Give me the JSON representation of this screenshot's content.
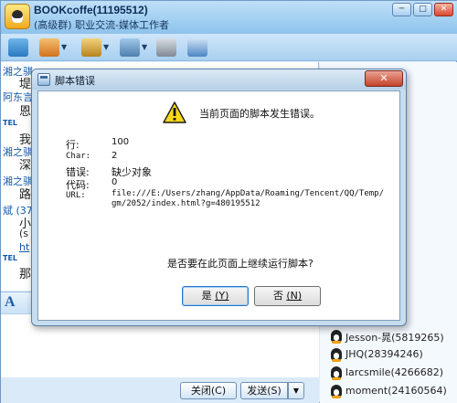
{
  "window": {
    "group_name": "BOOKcoffe(11195512)",
    "group_subtitle": "(高级群) 职业交流-媒体工作者",
    "controls": {
      "minimize": "─",
      "maximize": "□",
      "close": "✕"
    }
  },
  "toolbar": {
    "icons": [
      "group-chat-icon",
      "home-icon",
      "share-icon",
      "album-icon",
      "tools-icon",
      "settings-icon"
    ]
  },
  "chat": {
    "lines": [
      {
        "kind": "sender",
        "text": "湘之骐"
      },
      {
        "kind": "msg",
        "text": "堤"
      },
      {
        "kind": "sender",
        "text": "阿东言"
      },
      {
        "kind": "msg",
        "text": "恩"
      },
      {
        "kind": "tel",
        "text": "TEL"
      },
      {
        "kind": "msg",
        "text": "我"
      },
      {
        "kind": "sender",
        "text": "湘之骐"
      },
      {
        "kind": "msg",
        "text": "深"
      },
      {
        "kind": "sender",
        "text": "湘之骐"
      },
      {
        "kind": "msg",
        "text": "路"
      },
      {
        "kind": "sender",
        "text": "斌 (37"
      },
      {
        "kind": "msg",
        "text": "小"
      },
      {
        "kind": "msg",
        "text": "(s"
      },
      {
        "kind": "msg",
        "text": "ht"
      },
      {
        "kind": "tel",
        "text": "TEL"
      },
      {
        "kind": "msg",
        "text": "那"
      }
    ]
  },
  "members": [
    {
      "name": "Jesson-晁(5819265)"
    },
    {
      "name": "JHQ(28394246)"
    },
    {
      "name": "larcsmile(4266682)"
    },
    {
      "name": "moment(24160564)"
    }
  ],
  "bottom": {
    "close_label": "关闭(C)",
    "send_label": "发送(S)",
    "send_arrow": "▼",
    "format_icon": "A"
  },
  "dialog": {
    "title": "脚本错误",
    "close_label": "✕",
    "heading": "当前页面的脚本发生错误。",
    "fields": {
      "line_label": "行:",
      "line_value": "100",
      "char_label": "Char:",
      "char_value": "2",
      "error_label": "错误:",
      "error_value": "缺少对象",
      "code_label": "代码:",
      "code_value": "0",
      "url_label": "URL:",
      "url_line1": "file:///E:/Users/zhang/AppData/Roaming/Tencent/QQ/Temp/",
      "url_line2": "gm/2052/index.html?g=480195512"
    },
    "question": "是否要在此页面上继续运行脚本?",
    "yes_label": "是",
    "yes_key": "(Y)",
    "no_label": "否",
    "no_key": "(N)"
  }
}
